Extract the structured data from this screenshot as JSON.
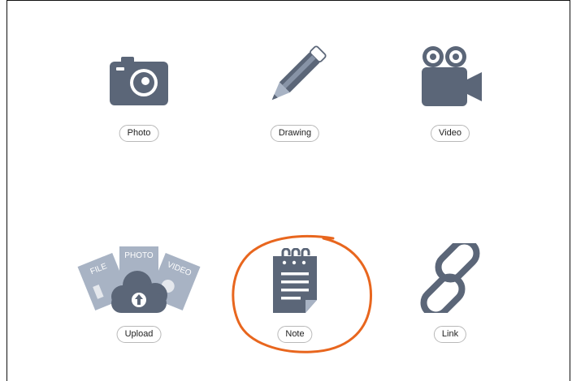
{
  "options": [
    {
      "label": "Photo"
    },
    {
      "label": "Drawing"
    },
    {
      "label": "Video"
    },
    {
      "label": "Upload",
      "sub_labels": [
        "FILE",
        "PHOTO",
        "VIDEO"
      ]
    },
    {
      "label": "Note"
    },
    {
      "label": "Link"
    }
  ],
  "colors": {
    "icon": "#5b6678",
    "icon_light": "#a8b3c4",
    "annotation": "#e8661e"
  }
}
